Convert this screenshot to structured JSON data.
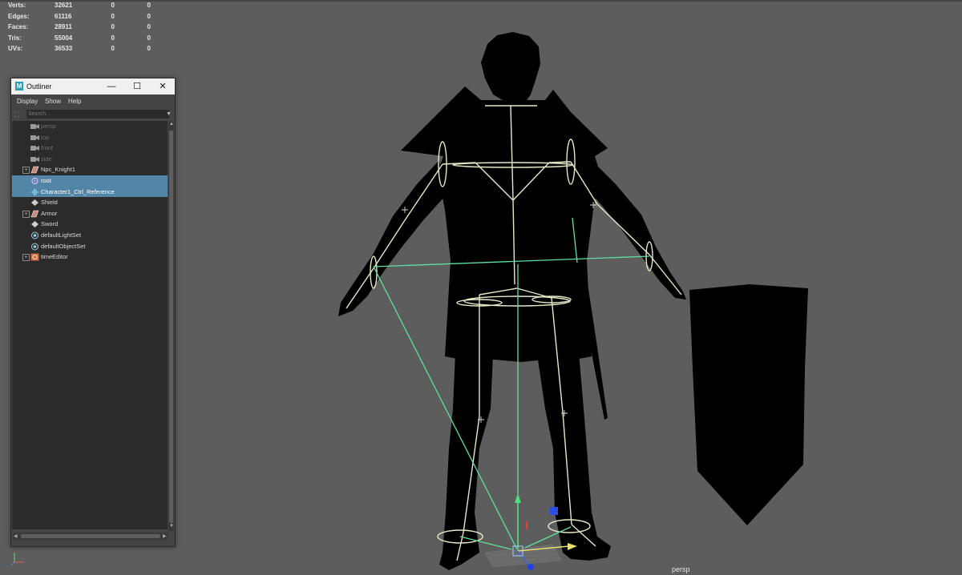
{
  "hud": [
    {
      "label": "Verts:",
      "v1": "32621",
      "v2": "0",
      "v3": "0"
    },
    {
      "label": "Edges:",
      "v1": "61116",
      "v2": "0",
      "v3": "0"
    },
    {
      "label": "Faces:",
      "v1": "28911",
      "v2": "0",
      "v3": "0"
    },
    {
      "label": "Tris:",
      "v1": "55004",
      "v2": "0",
      "v3": "0"
    },
    {
      "label": "UVs:",
      "v1": "36533",
      "v2": "0",
      "v3": "0"
    }
  ],
  "outliner": {
    "title": "Outliner",
    "logo": "M",
    "window_buttons": {
      "minimize": "—",
      "maximize": "☐",
      "close": "✕"
    },
    "menu": [
      "Display",
      "Show",
      "Help"
    ],
    "search_placeholder": "Search...",
    "items": [
      {
        "label": "persp",
        "icon": "camera-icon",
        "dim": true,
        "expand": false,
        "selected": false
      },
      {
        "label": "top",
        "icon": "camera-icon",
        "dim": true,
        "expand": false,
        "selected": false
      },
      {
        "label": "front",
        "icon": "camera-icon",
        "dim": true,
        "expand": false,
        "selected": false
      },
      {
        "label": "side",
        "icon": "camera-icon",
        "dim": true,
        "expand": false,
        "selected": false
      },
      {
        "label": "Npc_Knight1",
        "icon": "mesh-icon",
        "dim": false,
        "expand": true,
        "selected": false
      },
      {
        "label": "root",
        "icon": "joint-icon",
        "dim": false,
        "expand": false,
        "selected": true
      },
      {
        "label": "Character1_Ctrl_Reference",
        "icon": "ctrl-reference-icon",
        "dim": false,
        "expand": false,
        "selected": true
      },
      {
        "label": "Shield",
        "icon": "transform-icon",
        "dim": false,
        "expand": false,
        "selected": false
      },
      {
        "label": "Armor",
        "icon": "mesh-icon",
        "dim": false,
        "expand": true,
        "selected": false
      },
      {
        "label": "Sword",
        "icon": "transform-icon",
        "dim": false,
        "expand": false,
        "selected": false
      },
      {
        "label": "defaultLightSet",
        "icon": "set-icon",
        "dim": false,
        "expand": false,
        "selected": false
      },
      {
        "label": "defaultObjectSet",
        "icon": "set-icon",
        "dim": false,
        "expand": false,
        "selected": false
      },
      {
        "label": "timeEditor",
        "icon": "time-editor-icon",
        "dim": false,
        "expand": true,
        "selected": false
      }
    ]
  },
  "viewport": {
    "camera_label": "persp",
    "background": "#5d5d5d",
    "silhouette_color": "#000000",
    "skeleton_color": "#e8e8c8",
    "control_color": "#5fe0a0",
    "selection_color": "#5285a6"
  }
}
